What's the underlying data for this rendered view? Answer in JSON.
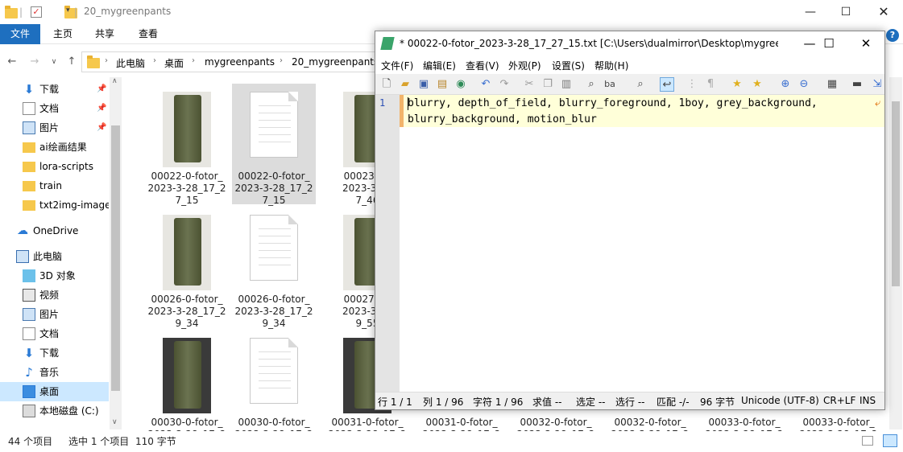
{
  "explorer": {
    "title": "20_mygreenpants",
    "ribbon_tabs": [
      "文件",
      "主页",
      "共享",
      "查看"
    ],
    "breadcrumb": [
      "此电脑",
      "桌面",
      "mygreenpants",
      "20_mygreenpants"
    ],
    "nav": [
      {
        "label": "下载",
        "icon": "download-icon",
        "pinned": true
      },
      {
        "label": "文档",
        "icon": "document-icon",
        "pinned": true
      },
      {
        "label": "图片",
        "icon": "picture-icon",
        "pinned": true
      },
      {
        "label": "ai绘画结果",
        "icon": "folder-icon",
        "pinned": false
      },
      {
        "label": "lora-scripts",
        "icon": "folder-icon",
        "pinned": false
      },
      {
        "label": "train",
        "icon": "folder-icon",
        "pinned": false
      },
      {
        "label": "txt2img-images",
        "icon": "folder-icon",
        "pinned": false
      },
      {
        "label": "OneDrive",
        "icon": "cloud-icon",
        "pinned": false
      },
      {
        "label": "此电脑",
        "icon": "computer-icon",
        "pinned": false
      },
      {
        "label": "3D 对象",
        "icon": "cube-icon",
        "pinned": false
      },
      {
        "label": "视频",
        "icon": "video-icon",
        "pinned": false
      },
      {
        "label": "图片",
        "icon": "picture-icon",
        "pinned": false
      },
      {
        "label": "文档",
        "icon": "document-icon",
        "pinned": false
      },
      {
        "label": "下载",
        "icon": "download-icon",
        "pinned": false
      },
      {
        "label": "音乐",
        "icon": "music-icon",
        "pinned": false
      },
      {
        "label": "桌面",
        "icon": "desktop-icon",
        "pinned": false,
        "selected": true
      },
      {
        "label": "本地磁盘 (C:)",
        "icon": "drive-icon",
        "pinned": false
      }
    ],
    "files": [
      [
        "00022-0-fotor_",
        "2023-3-28_17_2",
        "7_15"
      ],
      [
        "00022-0-fotor_",
        "2023-3-28_17_2",
        "7_15"
      ],
      [
        "00023-0-f",
        "2023-3-28",
        "7_46"
      ],
      [
        "00026-0-fotor_",
        "2023-3-28_17_2",
        "9_34"
      ],
      [
        "00026-0-fotor_",
        "2023-3-28_17_2",
        "9_34"
      ],
      [
        "00027-0-f",
        "2023-3-28",
        "9_55"
      ],
      [
        "00030-0-fotor_",
        "2023-3-28_17_2"
      ],
      [
        "00030-0-fotor_",
        "2023-3-28_17_2"
      ],
      [
        "00031-0-fotor_",
        "2023-3-28_17_2"
      ],
      [
        "00031-0-fotor_",
        "2023-3-28_17_2"
      ],
      [
        "00032-0-fotor_",
        "2023-3-28_17_2"
      ],
      [
        "00032-0-fotor_",
        "2023-3-28_17_2"
      ],
      [
        "00033-0-fotor_",
        "2023-3-28_17_2"
      ],
      [
        "00033-0-fotor_",
        "2023-3-28_17_2"
      ]
    ],
    "status": {
      "count": "44 个项目",
      "selected": "选中 1 个项目",
      "size": "110 字节"
    },
    "accent": "#1e6fbf"
  },
  "notepad": {
    "title": "* 00022-0-fotor_2023-3-28_17_27_15.txt [C:\\Users\\dualmirror\\Desktop\\mygree...",
    "menu": [
      "文件(F)",
      "编辑(E)",
      "查看(V)",
      "外观(P)",
      "设置(S)",
      "帮助(H)"
    ],
    "line_number": "1",
    "text_line1": "blurry, depth_of_field, blurry_foreground, 1boy, grey_background,",
    "text_line2": "blurry_background, motion_blur",
    "status": {
      "line": "行 1 / 1",
      "col": "列 1 / 96",
      "char": "字符 1 / 96",
      "sum": "求值 --",
      "sel": "选定 --",
      "selline": "选行 --",
      "match": "匹配 -/-",
      "bytes": "96 字节",
      "encoding": "Unicode (UTF-8)",
      "eol": "CR+LF",
      "ins": "INS"
    }
  }
}
